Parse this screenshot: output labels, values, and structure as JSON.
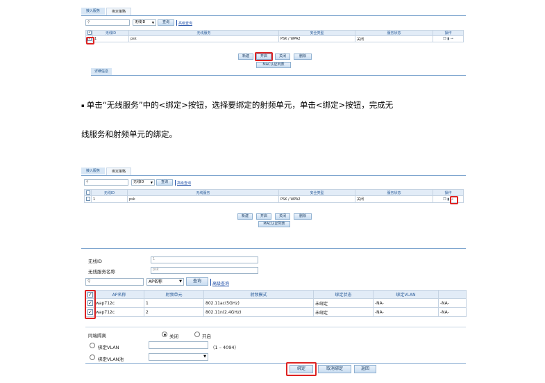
{
  "panel1": {
    "tabs": [
      "接入服务",
      "绑定策略"
    ],
    "search_placeholder": "",
    "search_icon": "search-icon",
    "filter_select": "无线ID",
    "query_button": "查询",
    "advanced_query": "高级查询",
    "columns": [
      "无线ID",
      "无线服务",
      "安全类型",
      "服务状态",
      "操作"
    ],
    "rows": [
      {
        "id": "1",
        "service": "psk",
        "security": "PSK / WPA2",
        "status": "关闭"
      }
    ],
    "buttons": [
      "新建",
      "开启",
      "关闭",
      "删除"
    ],
    "mac_button": "MAC认证列表",
    "detail_tab": "详细信息"
  },
  "instruction": {
    "bullet": "▪",
    "line1": "单击“无线服务”中的<绑定>按钮，选择要绑定的射频单元，单击<绑定>按钮，完成无",
    "line2": "线服务和射频单元的绑定。"
  },
  "panel2": {
    "tabs": [
      "接入服务",
      "绑定策略"
    ],
    "filter_select": "无线ID",
    "query_button": "查询",
    "advanced_query": "高级查询",
    "columns": [
      "无线ID",
      "无线服务",
      "安全类型",
      "服务状态",
      "操作"
    ],
    "rows": [
      {
        "id": "1",
        "service": "psk",
        "security": "PSK / WPA2",
        "status": "关闭"
      }
    ],
    "buttons": [
      "新建",
      "开启",
      "关闭",
      "删除"
    ],
    "mac_button": "MAC认证列表"
  },
  "panel3": {
    "wireless_id_label": "无线ID",
    "wireless_id_value": "1",
    "service_name_label": "无线服务名称",
    "service_name_value": "psk",
    "filter_select": "AP名称",
    "query_button": "查询",
    "advanced_query": "高级查询",
    "columns": [
      "AP名称",
      "射频单元",
      "射频模式",
      "绑定状态",
      "绑定VLAN",
      ""
    ],
    "rows": [
      {
        "ap": "wap712c",
        "radio": "1",
        "mode": "802.11ac(5GHz)",
        "bind": "未绑定",
        "vlan": "-NA-",
        "extra": "-NA-"
      },
      {
        "ap": "wap712c",
        "radio": "2",
        "mode": "802.11n(2.4GHz)",
        "bind": "未绑定",
        "vlan": "-NA-",
        "extra": "-NA-"
      }
    ],
    "isolation_label": "同端隔离",
    "isolation_off": "关闭",
    "isolation_on": "开启",
    "bind_vlan_label": "绑定VLAN",
    "vlan_range": "（1 – 4094）",
    "bind_vlan_pool_label": "绑定VLAN池",
    "bind_button": "绑定",
    "unbind_button": "取消绑定",
    "back_button": "返回"
  },
  "colors": {
    "highlight": "#d22222",
    "header_bg": "#e2ecf7",
    "link": "#1f4fa8"
  }
}
